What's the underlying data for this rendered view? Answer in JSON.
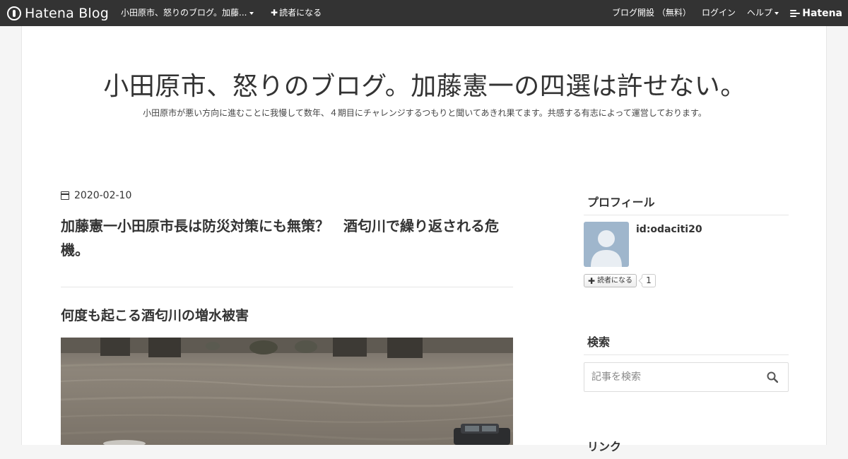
{
  "navbar": {
    "logo_text": "Hatena Blog",
    "blog_menu_label": "小田原市、怒りのブログ。加藤...",
    "subscribe_label": "読者になる",
    "open_blog_label": "ブログ開設 （無料）",
    "login_label": "ログイン",
    "help_label": "ヘルプ",
    "brand_label": "Hatena"
  },
  "header": {
    "title": "小田原市、怒りのブログ。加藤憲一の四選は許せない。",
    "description": "小田原市が悪い方向に進むことに我慢して数年、４期目にチャレンジするつもりと聞いてあきれ果てます。共感する有志によって運営しております。"
  },
  "entry": {
    "date": "2020-02-10",
    "title": "加藤憲一小田原市長は防災対策にも無策？　酒匂川で繰り返される危機。",
    "section_heading": "何度も起こる酒匂川の増水被害"
  },
  "sidebar": {
    "profile": {
      "title": "プロフィール",
      "user_id": "id:odaciti20",
      "subscribe_label": "読者になる",
      "subscriber_count": "1"
    },
    "search": {
      "title": "検索",
      "placeholder": "記事を検索"
    },
    "links": {
      "title": "リンク"
    }
  },
  "colors": {
    "navbar_bg": "#333333",
    "page_bg": "#f5f5f5",
    "avatar_bg": "#9fb6cc"
  }
}
